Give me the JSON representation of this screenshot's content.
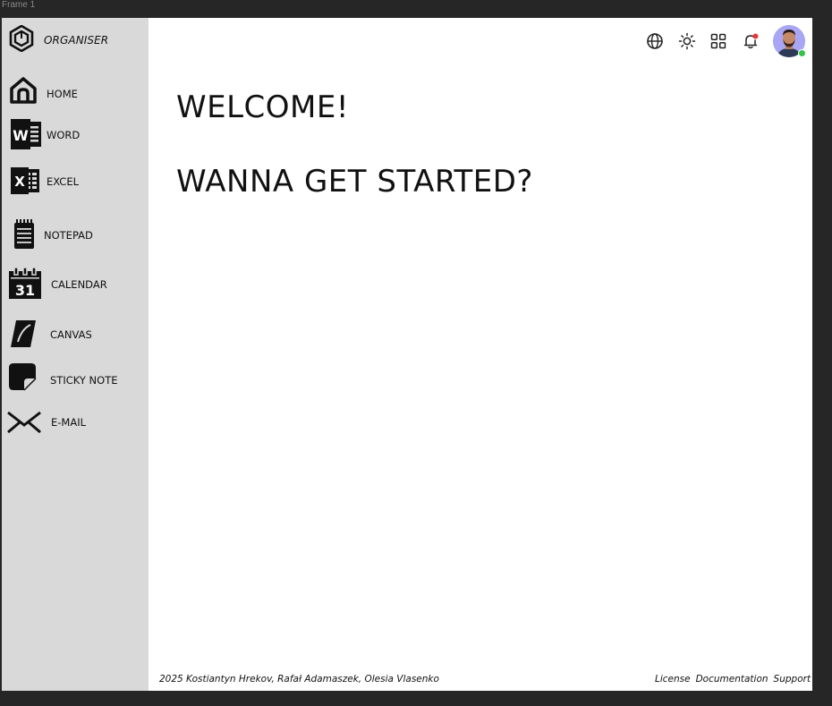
{
  "frame": {
    "label": "Frame 1"
  },
  "app": {
    "name": "ORGANISER"
  },
  "sidebar": {
    "items": [
      {
        "label": "HOME",
        "icon": "home-icon"
      },
      {
        "label": "WORD",
        "icon": "word-icon"
      },
      {
        "label": "EXCEL",
        "icon": "excel-icon"
      },
      {
        "label": "NOTEPAD",
        "icon": "notepad-icon"
      },
      {
        "label": "CALENDAR",
        "icon": "calendar-icon",
        "icon_text": "31"
      },
      {
        "label": "CANVAS",
        "icon": "canvas-icon"
      },
      {
        "label": "STICKY NOTE",
        "icon": "sticky-note-icon"
      },
      {
        "label": "E-MAIL",
        "icon": "mail-icon"
      }
    ]
  },
  "topbar": {
    "icons": [
      "globe-icon",
      "sun-icon",
      "grid-icon",
      "bell-icon"
    ],
    "notification_color": "#e53935",
    "status_color": "#36c24a",
    "avatar_bg": "#a9a6f5"
  },
  "main": {
    "welcome": "WELCOME!",
    "prompt": "WANNA GET STARTED?"
  },
  "footer": {
    "credits": "2025 Kostiantyn Hrekov, Rafał Adamaszek, Olesia Vlasenko",
    "links": [
      "License",
      "Documentation",
      "Support"
    ]
  }
}
